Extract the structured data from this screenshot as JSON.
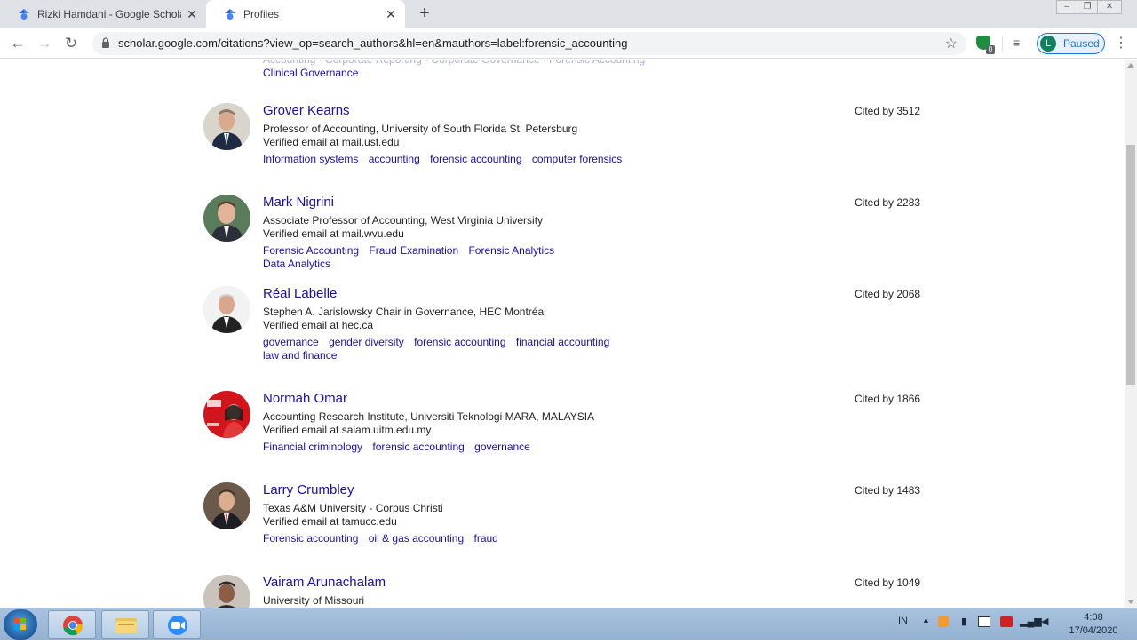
{
  "tabs": [
    {
      "title": "Rizki Hamdani - Google Scholar",
      "icon": "scholar-icon",
      "active": false
    },
    {
      "title": "Profiles",
      "icon": "scholar-icon",
      "active": true
    }
  ],
  "toolbar": {
    "url": "scholar.google.com/citations?view_op=search_authors&hl=en&mauthors=label:forensic_accounting",
    "profile_initial": "L",
    "profile_status": "Paused",
    "extension_badge": "0"
  },
  "previous_profile": {
    "clipped_tags": "Accounting · Corporate Reporting · Corporate Governance · Forensic Accounting",
    "last_tag": "Clinical Governance"
  },
  "profiles": [
    {
      "name": "Grover Kearns",
      "affiliation": "Professor of Accounting, University of South Florida St. Petersburg",
      "email": "Verified email at mail.usf.edu",
      "cited_by": "Cited by 3512",
      "tags": [
        "Information systems",
        "accounting",
        "forensic accounting",
        "computer forensics"
      ]
    },
    {
      "name": "Mark Nigrini",
      "affiliation": "Associate Professor of Accounting, West Virginia University",
      "email": "Verified email at mail.wvu.edu",
      "cited_by": "Cited by 2283",
      "tags": [
        "Forensic Accounting",
        "Fraud Examination",
        "Forensic Analytics",
        "Data Analytics"
      ]
    },
    {
      "name": "Réal Labelle",
      "affiliation": "Stephen A. Jarislowsky Chair in Governance, HEC Montréal",
      "email": "Verified email at hec.ca",
      "cited_by": "Cited by 2068",
      "tags": [
        "governance",
        "gender diversity",
        "forensic accounting",
        "financial accounting",
        "law and finance"
      ]
    },
    {
      "name": "Normah Omar",
      "affiliation": "Accounting Research Institute, Universiti Teknologi MARA, MALAYSIA",
      "email": "Verified email at salam.uitm.edu.my",
      "cited_by": "Cited by 1866",
      "tags": [
        "Financial criminology",
        "forensic accounting",
        "governance"
      ]
    },
    {
      "name": "Larry Crumbley",
      "affiliation": "Texas A&M University - Corpus Christi",
      "email": "Verified email at tamucc.edu",
      "cited_by": "Cited by 1483",
      "tags": [
        "Forensic accounting",
        "oil & gas accounting",
        "fraud"
      ]
    },
    {
      "name": "Vairam Arunachalam",
      "affiliation": "University of Missouri",
      "email": "",
      "cited_by": "Cited by 1049",
      "tags": []
    }
  ],
  "taskbar": {
    "language": "IN",
    "time": "4:08",
    "date": "17/04/2020",
    "apps": [
      "chrome-icon",
      "file-explorer-icon",
      "zoom-icon"
    ]
  },
  "colors": {
    "link": "#1a0dab",
    "text": "#222222",
    "tabstrip": "#dee1e6",
    "profile_accent": "#1a73e8"
  }
}
